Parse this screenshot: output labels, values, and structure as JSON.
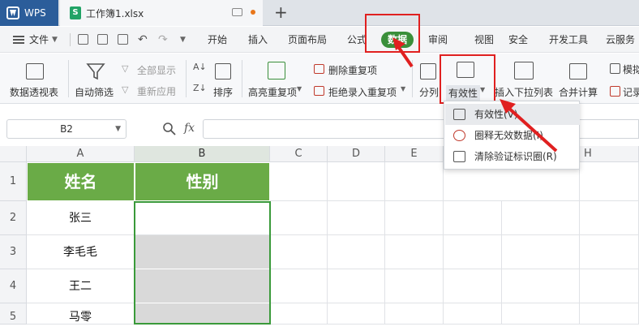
{
  "tabs": {
    "wps_label": "WPS",
    "doc_title": "工作簿1.xlsx",
    "new_tab": "+"
  },
  "menu": {
    "file_label": "文件",
    "items": [
      "开始",
      "插入",
      "页面布局",
      "公式",
      "数据",
      "审阅",
      "视图",
      "安全",
      "开发工具",
      "云服务"
    ]
  },
  "ribbon": {
    "pivot": "数据透视表",
    "autofilter": "自动筛选",
    "show_all": "全部显示",
    "reapply": "重新应用",
    "sort": "排序",
    "highlight_dup": "高亮重复项",
    "delete_dup": "删除重复项",
    "reject_dup": "拒绝录入重复项",
    "split": "分列",
    "validity": "有效性",
    "insert_dropdown": "插入下拉列表",
    "merge_calc": "合并计算",
    "simulate": "模拟",
    "record": "记录"
  },
  "dropdown_menu": {
    "items": [
      "有效性(V)",
      "圈释无效数据(I)",
      "清除验证标识圈(R)"
    ]
  },
  "formula_bar": {
    "name_box": "B2",
    "fx": "fx"
  },
  "sheet": {
    "columns": [
      "A",
      "B",
      "C",
      "D",
      "E",
      "F",
      "G",
      "H"
    ],
    "rows": [
      "1",
      "2",
      "3",
      "4",
      "5"
    ],
    "header": [
      "姓名",
      "性别"
    ],
    "names": [
      "张三",
      "李毛毛",
      "王二",
      "马零"
    ]
  },
  "colors": {
    "accent_green": "#6aab47",
    "data_tab_green": "#3a8f3a",
    "annotation_red": "#e02020",
    "wps_blue": "#2b5d9a"
  }
}
